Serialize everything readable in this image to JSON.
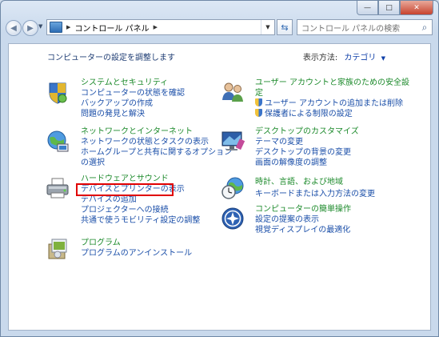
{
  "window": {
    "buttons": {
      "minimize": "—",
      "maximize": "□",
      "close": "✕"
    }
  },
  "nav": {
    "back_icon": "back-arrow-icon",
    "forward_icon": "forward-arrow-icon",
    "breadcrumb": [
      "コントロール パネル"
    ],
    "search_placeholder": "コントロール パネルの検索"
  },
  "main": {
    "heading": "コンピューターの設定を調整します",
    "view_by_label": "表示方法:",
    "view_by_value": "カテゴリ"
  },
  "categories": [
    {
      "icon": "shield-security-icon",
      "title": "システムとセキュリティ",
      "links": [
        "コンピューターの状態を確認",
        "バックアップの作成",
        "問題の発見と解決"
      ]
    },
    {
      "icon": "network-globe-icon",
      "title": "ネットワークとインターネット",
      "links": [
        "ネットワークの状態とタスクの表示",
        "ホームグループと共有に関するオプション",
        "の選択"
      ]
    },
    {
      "icon": "printer-icon",
      "title": "ハードウェアとサウンド",
      "links": [
        "デバイスとプリンターの表示",
        "デバイスの追加",
        "プロジェクターへの接続",
        "共通で使うモビリティ設定の調整"
      ]
    },
    {
      "icon": "programs-box-icon",
      "title": "プログラム",
      "links": [
        "プログラムのアンインストール"
      ]
    },
    {
      "icon": "users-icon",
      "title": "ユーザー アカウントと家族のための安全設",
      "title2": "定",
      "links": [
        "ユーザー アカウントの追加または削除",
        "保護者による制限の設定"
      ]
    },
    {
      "icon": "desktop-appearance-icon",
      "title": "デスクトップのカスタマイズ",
      "links": [
        "テーマの変更",
        "デスクトップの背景の変更",
        "画面の解像度の調整"
      ]
    },
    {
      "icon": "clock-globe-icon",
      "title": "時計、言語、および地域",
      "links": [
        "キーボードまたは入力方法の変更"
      ]
    },
    {
      "icon": "ease-of-access-icon",
      "title": "コンピューターの簡単操作",
      "links": [
        "設定の提案の表示",
        "視覚ディスプレイの最適化"
      ]
    }
  ],
  "colors": {
    "title_green": "#1c8a2b",
    "link_blue": "#1a4ea8",
    "highlight_red": "#e00000"
  }
}
